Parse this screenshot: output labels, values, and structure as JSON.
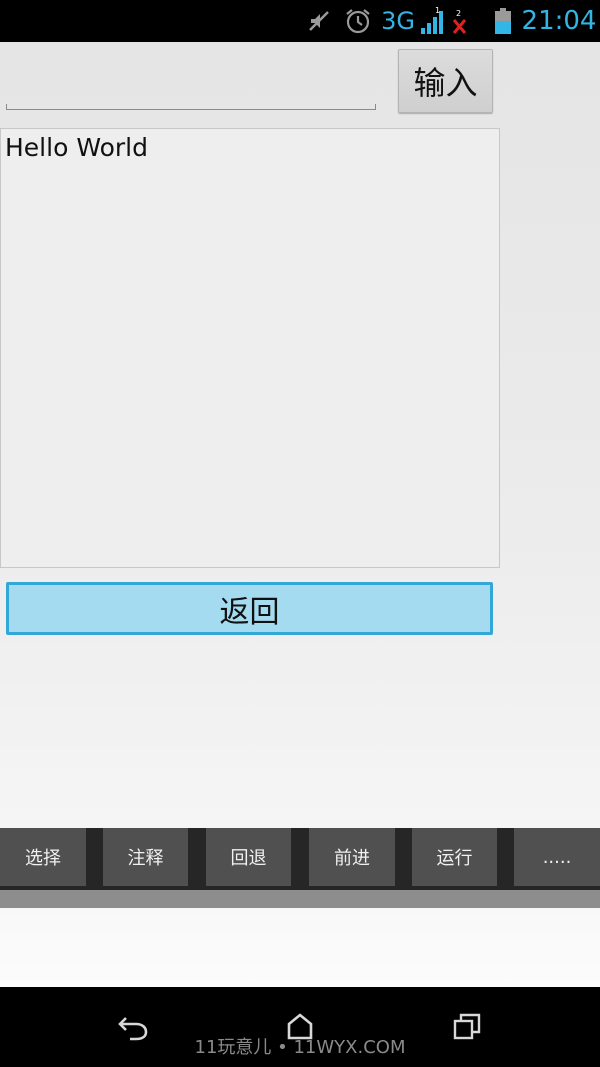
{
  "status_bar": {
    "network": "3G",
    "sim1_label": "1",
    "sim2_label": "2",
    "time": "21:04",
    "accent_color": "#33b5e5",
    "icons": [
      "mute-icon",
      "alarm-icon",
      "signal-icon",
      "no-signal-icon",
      "battery-icon"
    ]
  },
  "input_row": {
    "value": "",
    "placeholder": "",
    "button_label": "输入"
  },
  "output": {
    "text": "Hello World"
  },
  "back_button": {
    "label": "返回",
    "color": "#a4dbf0",
    "border_color": "#33a8d6"
  },
  "toolbar": {
    "items": [
      {
        "label": "选择"
      },
      {
        "label": "注释"
      },
      {
        "label": "回退"
      },
      {
        "label": "前进"
      },
      {
        "label": "运行"
      },
      {
        "label": "....."
      }
    ]
  },
  "nav_bar": {
    "icons": [
      "back-icon",
      "home-icon",
      "recent-apps-icon"
    ]
  },
  "watermark": {
    "text": "11玩意儿 • 11WYX.COM"
  }
}
